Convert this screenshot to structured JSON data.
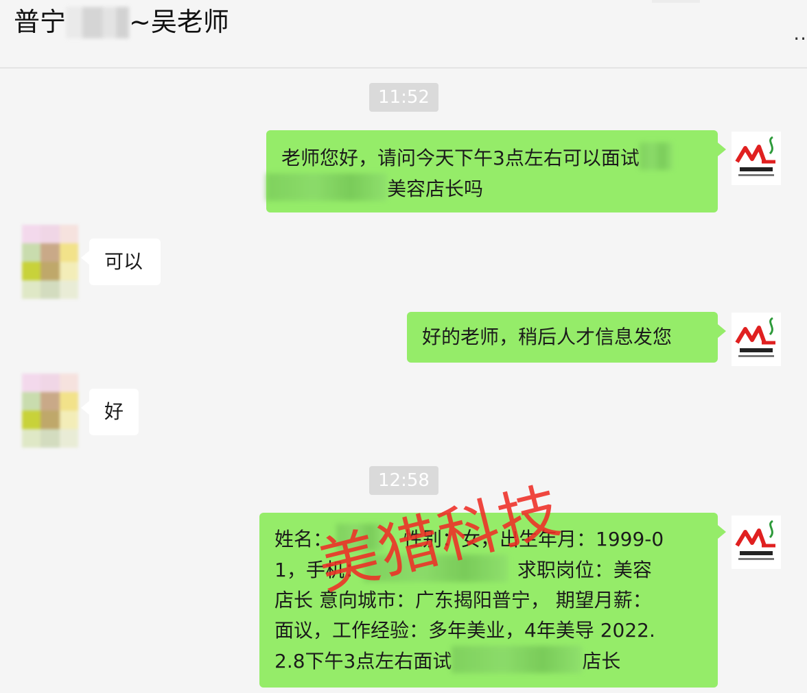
{
  "chat": {
    "title_prefix": "普宁",
    "title_suffix": "~吴老师",
    "more_label": "··"
  },
  "messages": {
    "time1": "11:52",
    "m1_line1": "老师您好，请问今天下午3点左右可以面试",
    "m1_line2": "美容店长吗",
    "m2": "可以",
    "m3": "好的老师，稍后人才信息发您",
    "m4": "好",
    "time2": "12:58",
    "m5": {
      "l1a": "姓名：",
      "l1b": "性别：女，出生年月：1999-0",
      "l2a": "1，手机：",
      "l2b": "求职岗位：美容",
      "l3": "店长 意向城市：广东揭阳普宁， 期望月薪：",
      "l4": "面议，工作经验：多年美业，4年美导 2022.",
      "l5a": "2.8下午3点左右面试",
      "l5b": "店长"
    }
  },
  "watermark": {
    "text": "美猎科技"
  },
  "colors": {
    "me_bubble": "#95ec69",
    "them_bubble": "#ffffff",
    "bg": "#f5f5f5",
    "watermark": "#ee2e26"
  },
  "icons": {
    "me_avatar": "meilie-logo-icon",
    "more": "more-dots-icon"
  }
}
